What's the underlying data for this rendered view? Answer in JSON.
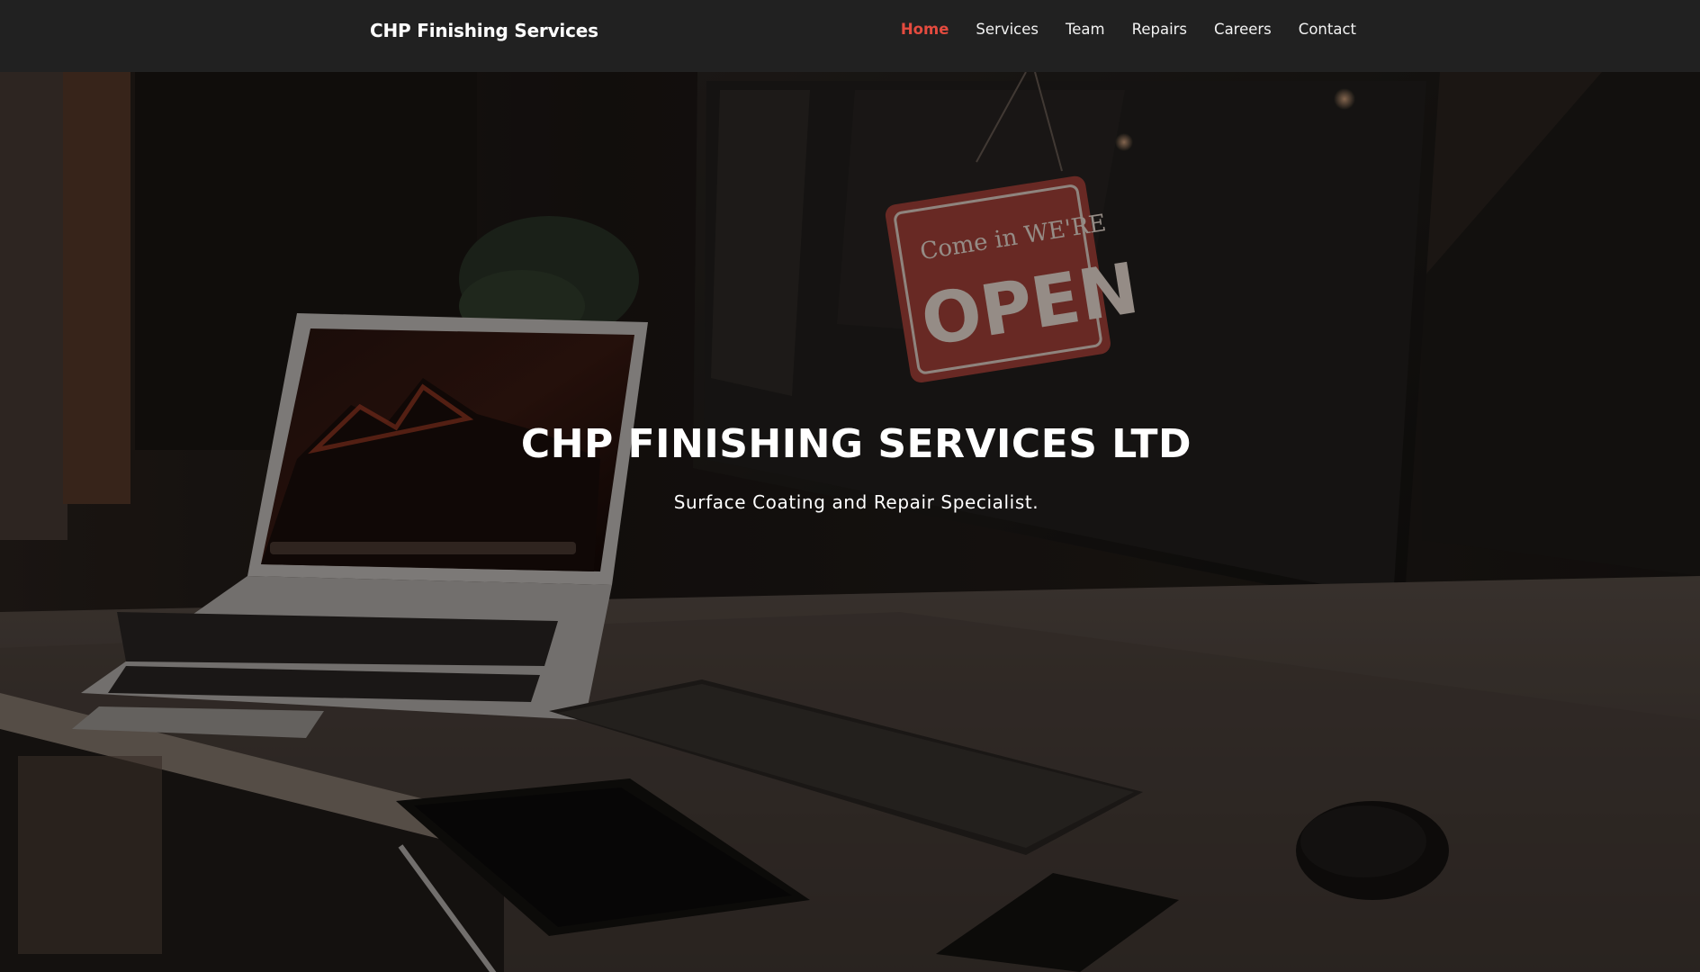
{
  "nav": {
    "brand": "CHP Finishing Services",
    "items": [
      {
        "label": "Home",
        "active": true
      },
      {
        "label": "Services",
        "active": false
      },
      {
        "label": "Team",
        "active": false
      },
      {
        "label": "Repairs",
        "active": false
      },
      {
        "label": "Careers",
        "active": false
      },
      {
        "label": "Contact",
        "active": false
      }
    ]
  },
  "hero": {
    "title": "CHP FINISHING SERVICES LTD",
    "subtitle": "Surface Coating and Repair Specialist.",
    "sign_top": "Come in WE'RE",
    "sign_main": "OPEN"
  },
  "colors": {
    "navbar_bg": "#212121",
    "active_link": "#e44b3f",
    "text": "#ffffff"
  }
}
